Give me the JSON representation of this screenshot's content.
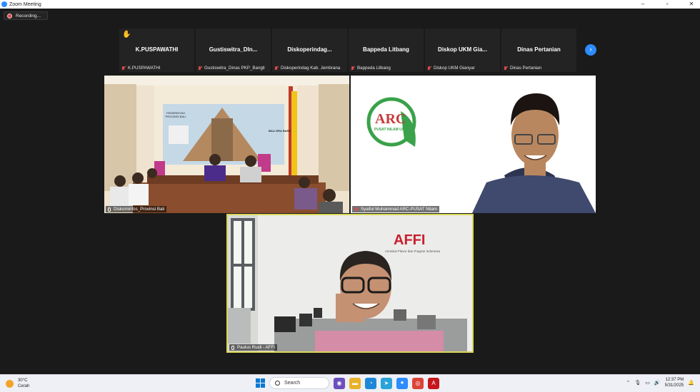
{
  "window": {
    "title": "Zoom Meeting"
  },
  "recording": {
    "label": "Recording..."
  },
  "strip": [
    {
      "name": "K.PUSPAWATHI",
      "label": "K.PUSPAWATHI",
      "hand": true
    },
    {
      "name": "Gustiswitra_DIn...",
      "label": "Gustiswitra_Dinas PKP_Bangli"
    },
    {
      "name": "Diskoperindag...",
      "label": "Diskoperindag Kab. Jembrana"
    },
    {
      "name": "Bappeda Litbang",
      "label": "Bappeda Litbang"
    },
    {
      "name": "Diskop UKM Gia...",
      "label": "Diskop UKM Gianyar"
    },
    {
      "name": "Dinas Pertanian",
      "label": "Dinas Pertanian"
    }
  ],
  "videos": {
    "v1": {
      "label": "Diskominfos_Provinsi Bali",
      "backdrop_text": "PEMERINTAH PROVINSI BALI",
      "banner_text": "BALI ERA BARU"
    },
    "v2": {
      "label": "Syaiful Muhammad ARC-PUSAT Nilam",
      "logo": "ARC",
      "logo_sub": "PUSAT NILAM USK"
    },
    "v3": {
      "label": "Paulus Rusli - AFFI",
      "logo": "AFFI",
      "logo_sub": "Asosiasi Flavor dan Fragran Indonesia"
    }
  },
  "taskbar": {
    "temp": "30°C",
    "condition": "Cerah",
    "search": "Search",
    "time": "12:37 PM",
    "date": "5/31/2025"
  },
  "colors": {
    "accent": "#2d8cff",
    "active_speaker": "#d9d65a",
    "muted": "#e04b4b"
  }
}
